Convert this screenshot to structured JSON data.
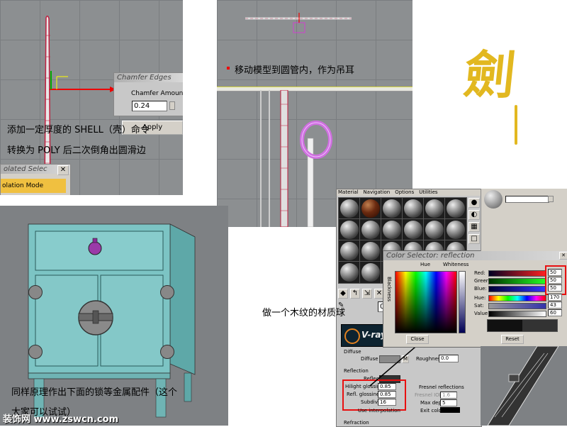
{
  "panel1": {
    "dialog_title": "Chamfer Edges",
    "amount_label": "Chamfer Amount:",
    "amount_value": "0.24",
    "apply_label": "Apply",
    "caption_1": "添加一定厚度的 SHELL（壳）命令",
    "caption_2": "转换为 POLY 后二次倒角出圆滑边",
    "isolated_title": "olated Selec",
    "isolation_mode": "olation Mode"
  },
  "panel2": {
    "caption": "移动模型到圆管内，作为吊耳"
  },
  "logo": {
    "glyph": "劍"
  },
  "panel3": {
    "caption_1": "同样原理作出下面的锁等金属配件（这个",
    "caption_2": "大家可以试试）"
  },
  "watermark": "装饰网 www.zswcn.com",
  "material_editor": {
    "menu": [
      "Material",
      "Navigation",
      "Options",
      "Utilities"
    ],
    "slot_id": "02",
    "vray_logo": "V-ray",
    "diffuse_group": "Diffuse",
    "diffuse_label": "Diffuse",
    "diffuse_map": "M",
    "roughness_label": "Roughness",
    "roughness_value": "0.0",
    "reflection_group": "Reflection",
    "reflect_label": "Reflect",
    "hilight_label": "Hilight glossiness",
    "hilight_value": "0.85",
    "refl_gloss_label": "Refl. glossiness",
    "refl_gloss_value": "0.85",
    "subdivs_label": "Subdivs",
    "subdivs_value": "16",
    "fresnel_label": "Fresnel reflections",
    "fresnel_ior_label": "Fresnel IOR",
    "fresnel_ior_value": "1.6",
    "max_depth_label": "Max depth",
    "max_depth_value": "5",
    "exit_color_label": "Exit color",
    "use_interp_label": "Use interpolation",
    "refraction_group": "Refraction",
    "caption": "做一个木纹的材质球"
  },
  "color_selector": {
    "title": "Color Selector: reflection",
    "hue_label": "Hue",
    "whiteness_label": "Whiteness",
    "blackness_label": "Blackness",
    "red_label": "Red:",
    "red_value": "50",
    "green_label": "Green:",
    "green_value": "50",
    "blue_label": "Blue:",
    "blue_value": "50",
    "hue2_label": "Hue:",
    "hue2_value": "170",
    "sat_label": "Sat:",
    "sat_value": "43",
    "value_label": "Value:",
    "value_value": "60",
    "close_label": "Close",
    "reset_label": "Reset"
  },
  "colors": {
    "cabinet": "#7cc4c4",
    "highlight_red": "#e81010",
    "logo_gold": "#e2b820"
  }
}
